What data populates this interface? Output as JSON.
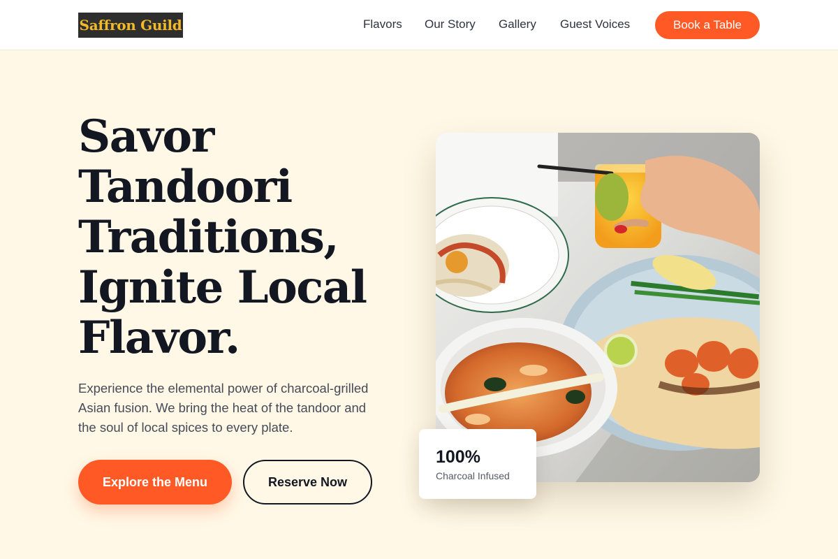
{
  "brand": {
    "name": "Saffron Guild"
  },
  "nav": {
    "links": [
      "Flavors",
      "Our Story",
      "Gallery",
      "Guest Voices"
    ],
    "cta_label": "Book a Table"
  },
  "hero": {
    "title_lines": [
      "Savor",
      "Tandoori",
      "Traditions,",
      "Ignite Local",
      "Flavor."
    ],
    "description_lines": [
      "Experience the elemental power of charcoal-grilled",
      "Asian fusion. We bring the heat of the tandoor and",
      "the soul of local spices to every plate."
    ],
    "primary_button": "Explore the Menu",
    "secondary_button": "Reserve Now"
  },
  "stat": {
    "value": "100%",
    "label": "Charcoal Infused"
  },
  "colors": {
    "accent": "#ff5a26",
    "background": "#fff8e6",
    "text_dark": "#131722",
    "logo_bg": "#2e2e2e",
    "logo_text": "#f2b928"
  },
  "image": {
    "subject": "food-photo-curry-and-grilled-shrimp"
  }
}
